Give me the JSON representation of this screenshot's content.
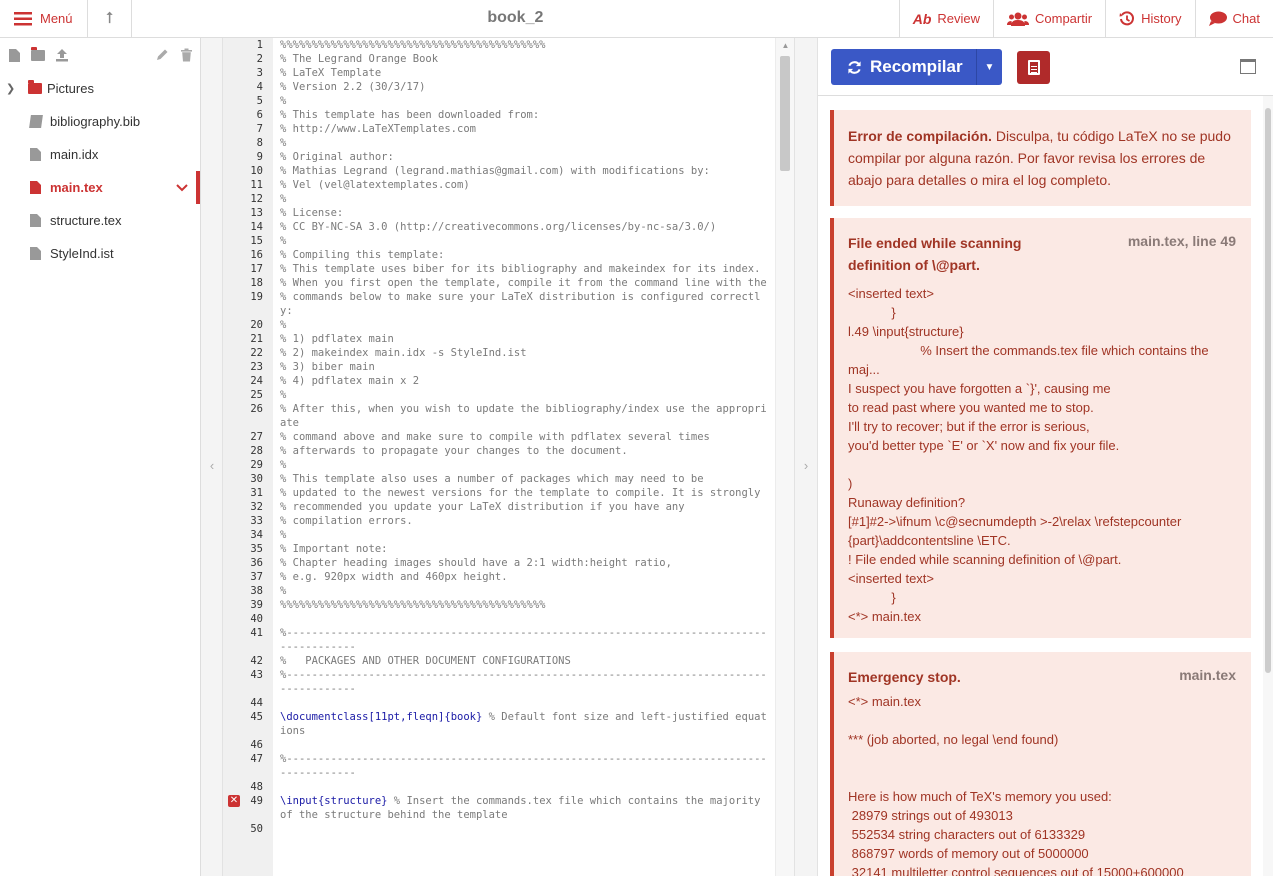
{
  "topbar": {
    "menu_label": "Menú",
    "title": "book_2",
    "review_label": "Review",
    "share_label": "Compartir",
    "history_label": "History",
    "chat_label": "Chat"
  },
  "file_tree": {
    "items": [
      {
        "label": "Pictures",
        "type": "folder"
      },
      {
        "label": "bibliography.bib",
        "type": "bib"
      },
      {
        "label": "main.idx",
        "type": "file"
      },
      {
        "label": "main.tex",
        "type": "file",
        "selected": true
      },
      {
        "label": "structure.tex",
        "type": "file"
      },
      {
        "label": "StyleInd.ist",
        "type": "file"
      }
    ]
  },
  "editor": {
    "lines": [
      {
        "n": "1",
        "t": "%%%%%%%%%%%%%%%%%%%%%%%%%%%%%%%%%%%%%%%%%%"
      },
      {
        "n": "2",
        "t": "% The Legrand Orange Book"
      },
      {
        "n": "3",
        "t": "% LaTeX Template"
      },
      {
        "n": "4",
        "t": "% Version 2.2 (30/3/17)"
      },
      {
        "n": "5",
        "t": "%"
      },
      {
        "n": "6",
        "t": "% This template has been downloaded from:"
      },
      {
        "n": "7",
        "t": "% http://www.LaTeXTemplates.com"
      },
      {
        "n": "8",
        "t": "%"
      },
      {
        "n": "9",
        "t": "% Original author:"
      },
      {
        "n": "10",
        "t": "% Mathias Legrand (legrand.mathias@gmail.com) with modifications by:"
      },
      {
        "n": "11",
        "t": "% Vel (vel@latextemplates.com)"
      },
      {
        "n": "12",
        "t": "%"
      },
      {
        "n": "13",
        "t": "% License:"
      },
      {
        "n": "14",
        "t": "% CC BY-NC-SA 3.0 (http://creativecommons.org/licenses/by-nc-sa/3.0/)"
      },
      {
        "n": "15",
        "t": "%"
      },
      {
        "n": "16",
        "t": "% Compiling this template:"
      },
      {
        "n": "17",
        "t": "% This template uses biber for its bibliography and makeindex for its index."
      },
      {
        "n": "18",
        "t": "% When you first open the template, compile it from the command line with the"
      },
      {
        "n": "19",
        "t": "% commands below to make sure your LaTeX distribution is configured correctly:"
      },
      {
        "n": "20",
        "t": "%"
      },
      {
        "n": "21",
        "t": "% 1) pdflatex main"
      },
      {
        "n": "22",
        "t": "% 2) makeindex main.idx -s StyleInd.ist"
      },
      {
        "n": "23",
        "t": "% 3) biber main"
      },
      {
        "n": "24",
        "t": "% 4) pdflatex main x 2"
      },
      {
        "n": "25",
        "t": "%"
      },
      {
        "n": "26",
        "t": "% After this, when you wish to update the bibliography/index use the appropriate"
      },
      {
        "n": "27",
        "t": "% command above and make sure to compile with pdflatex several times"
      },
      {
        "n": "28",
        "t": "% afterwards to propagate your changes to the document."
      },
      {
        "n": "29",
        "t": "%"
      },
      {
        "n": "30",
        "t": "% This template also uses a number of packages which may need to be"
      },
      {
        "n": "31",
        "t": "% updated to the newest versions for the template to compile. It is strongly"
      },
      {
        "n": "32",
        "t": "% recommended you update your LaTeX distribution if you have any"
      },
      {
        "n": "33",
        "t": "% compilation errors."
      },
      {
        "n": "34",
        "t": "%"
      },
      {
        "n": "35",
        "t": "% Important note:"
      },
      {
        "n": "36",
        "t": "% Chapter heading images should have a 2:1 width:height ratio,"
      },
      {
        "n": "37",
        "t": "% e.g. 920px width and 460px height."
      },
      {
        "n": "38",
        "t": "%"
      },
      {
        "n": "39",
        "t": "%%%%%%%%%%%%%%%%%%%%%%%%%%%%%%%%%%%%%%%%%%"
      },
      {
        "n": "40",
        "t": ""
      },
      {
        "n": "41",
        "t": "%----------------------------------------------------------------------------------------"
      },
      {
        "n": "42",
        "t": "%   PACKAGES AND OTHER DOCUMENT CONFIGURATIONS"
      },
      {
        "n": "43",
        "t": "%----------------------------------------------------------------------------------------"
      },
      {
        "n": "44",
        "t": ""
      },
      {
        "n": "45",
        "cmd": "\\documentclass",
        "arg": "[11pt,fleqn]{book}",
        "t": " % Default font size and left-justified equations"
      },
      {
        "n": "46",
        "t": ""
      },
      {
        "n": "47",
        "t": "%----------------------------------------------------------------------------------------"
      },
      {
        "n": "48",
        "t": ""
      },
      {
        "n": "49",
        "cmd": "\\input",
        "arg": "{structure}",
        "t": " % Insert the commands.tex file which contains the majority of the structure behind the template",
        "error": true
      },
      {
        "n": "50",
        "t": ""
      }
    ]
  },
  "pdf": {
    "recompile_label": "Recompilar"
  },
  "log": {
    "summary_title": "Error de compilación.",
    "summary_text": " Disculpa, tu código LaTeX no se pudo compilar por alguna razón. Por favor revisa los errores de abajo para detalles o mira el log completo.",
    "entries": [
      {
        "title": "File ended while scanning definition of \\@part.",
        "location": "main.tex, line 49",
        "body": "<inserted text> \n            }\nl.49 \\input{structure}\n                    % Insert the commands.tex file which contains the maj...\nI suspect you have forgotten a `}', causing me\nto read past where you wanted me to stop.\nI'll try to recover; but if the error is serious,\nyou'd better type `E' or `X' now and fix your file.\n\n)\nRunaway definition?\n[#1]#2->\\ifnum \\c@secnumdepth >-2\\relax \\refstepcounter {part}\\addcontentsline \\ETC.\n! File ended while scanning definition of \\@part.\n<inserted text> \n            }\n<*> main.tex"
      },
      {
        "title": "Emergency stop.",
        "location": "main.tex",
        "body": "<*> main.tex\n\n*** (job aborted, no legal \\end found)\n\n\nHere is how much of TeX's memory you used:\n 28979 strings out of 493013\n 552534 string characters out of 6133329\n 868797 words of memory out of 5000000\n 32141 multiletter control sequences out of 15000+600000"
      }
    ]
  }
}
